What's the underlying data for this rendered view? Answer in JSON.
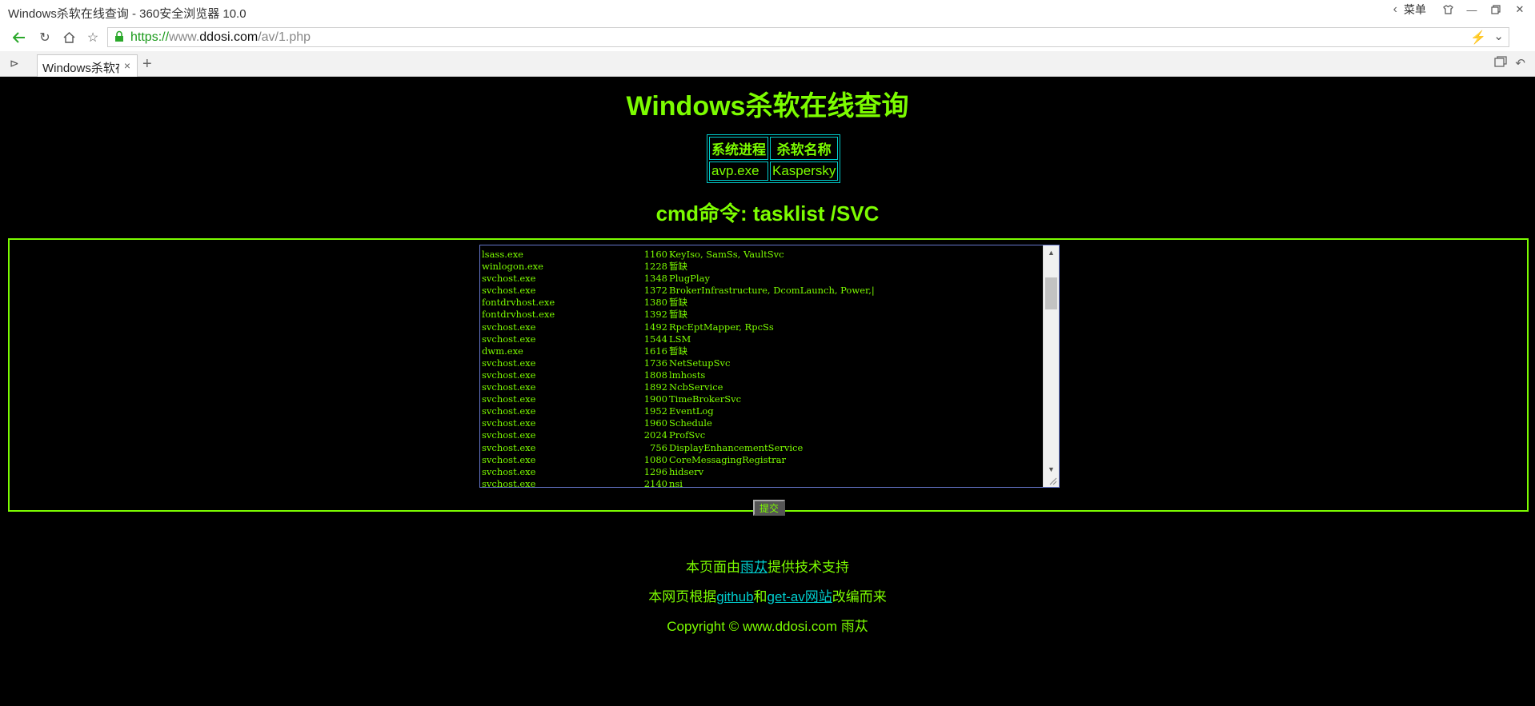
{
  "browser": {
    "window_title": "Windows杀软在线查询 - 360安全浏览器 10.0",
    "menu_label": "菜单",
    "url_scheme": "https://",
    "url_host_prefix": "www.",
    "url_domain": "ddosi.com",
    "url_path": "/av/1.php",
    "tab_title": "Windows杀软在线查询",
    "newtab_symbol": "+",
    "accent_color": "#2db82d"
  },
  "page": {
    "heading": "Windows杀软在线查询",
    "table": {
      "headers": [
        "系统进程",
        "杀软名称"
      ],
      "rows": [
        [
          "avp.exe",
          "Kaspersky"
        ]
      ]
    },
    "cmd_heading": "cmd命令: tasklist /SVC",
    "submit_label": "提交",
    "footer1": {
      "prefix": "本页面由",
      "link": "雨苁",
      "suffix": "提供技术支持"
    },
    "footer2": {
      "prefix": "本网页根据",
      "link1": "github",
      "mid": "和",
      "link2": "get-av网站",
      "suffix": "改编而来"
    },
    "footer3": "Copyright © www.ddosi.com 雨苁",
    "text_color": "#7cfc00",
    "link_color": "#00cccc"
  },
  "output_lines": [
    {
      "image": "lsass.exe",
      "pid": "1160",
      "services": "KeyIso, SamSs, VaultSvc"
    },
    {
      "image": "winlogon.exe",
      "pid": "1228",
      "services": "暂缺"
    },
    {
      "image": "svchost.exe",
      "pid": "1348",
      "services": "PlugPlay"
    },
    {
      "image": "svchost.exe",
      "pid": "1372",
      "services": "BrokerInfrastructure, DcomLaunch, Power,|"
    },
    {
      "image": "fontdrvhost.exe",
      "pid": "1380",
      "services": "暂缺"
    },
    {
      "image": "fontdrvhost.exe",
      "pid": "1392",
      "services": "暂缺"
    },
    {
      "image": "svchost.exe",
      "pid": "1492",
      "services": "RpcEptMapper, RpcSs"
    },
    {
      "image": "svchost.exe",
      "pid": "1544",
      "services": "LSM"
    },
    {
      "image": "dwm.exe",
      "pid": "1616",
      "services": "暂缺"
    },
    {
      "image": "svchost.exe",
      "pid": "1736",
      "services": "NetSetupSvc"
    },
    {
      "image": "svchost.exe",
      "pid": "1808",
      "services": "lmhosts"
    },
    {
      "image": "svchost.exe",
      "pid": "1892",
      "services": "NcbService"
    },
    {
      "image": "svchost.exe",
      "pid": "1900",
      "services": "TimeBrokerSvc"
    },
    {
      "image": "svchost.exe",
      "pid": "1952",
      "services": "EventLog"
    },
    {
      "image": "svchost.exe",
      "pid": "1960",
      "services": "Schedule"
    },
    {
      "image": "svchost.exe",
      "pid": "2024",
      "services": "ProfSvc"
    },
    {
      "image": "svchost.exe",
      "pid": "756",
      "services": "DisplayEnhancementService"
    },
    {
      "image": "svchost.exe",
      "pid": "1080",
      "services": "CoreMessagingRegistrar"
    },
    {
      "image": "svchost.exe",
      "pid": "1296",
      "services": "hidserv"
    },
    {
      "image": "svchost.exe",
      "pid": "2140",
      "services": "nsi"
    }
  ]
}
